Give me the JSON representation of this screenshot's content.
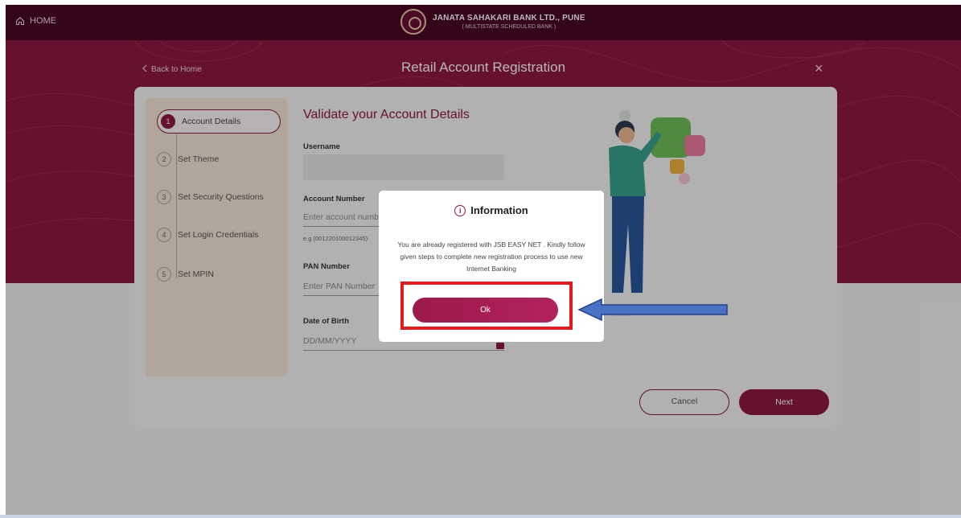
{
  "topbar": {
    "home_label": "HOME",
    "bank_name": "JANATA SAHAKARI BANK LTD., PUNE",
    "bank_sub": "( MULTISTATE SCHEDULED BANK )"
  },
  "subbar": {
    "back_label": "Back to Home",
    "page_title": "Retail Account Registration",
    "close_symbol": "×"
  },
  "steps": [
    {
      "num": "1",
      "label": "Account Details",
      "active": true
    },
    {
      "num": "2",
      "label": "Set Theme",
      "active": false
    },
    {
      "num": "3",
      "label": "Set Security Questions",
      "active": false
    },
    {
      "num": "4",
      "label": "Set Login Credentials",
      "active": false
    },
    {
      "num": "5",
      "label": "Set MPIN",
      "active": false
    }
  ],
  "form": {
    "title": "Validate your Account Details",
    "username_label": "Username",
    "username_value": "",
    "account_label": "Account Number",
    "account_placeholder": "Enter account numb",
    "account_hint": "e.g (001220100012345)",
    "pan_label": "PAN Number",
    "pan_placeholder": "Enter PAN Number",
    "dob_label": "Date of Birth",
    "dob_placeholder": "DD/MM/YYYY"
  },
  "buttons": {
    "cancel": "Cancel",
    "next": "Next"
  },
  "modal": {
    "title": "Information",
    "message": "You are already registered with JSB EASY NET . Kindly follow given steps to complete new registration process to use new Internet Banking",
    "ok_label": "Ok"
  },
  "icons": {
    "home": "home-icon",
    "back": "chevron-left-icon",
    "close": "close-icon",
    "info": "info-icon",
    "calendar": "calendar-icon",
    "arrow": "arrow-left-icon"
  },
  "colors": {
    "brand": "#8e1843",
    "topbar": "#4a0725",
    "highlight": "#e31b1b",
    "arrow": "#4a72c4"
  }
}
